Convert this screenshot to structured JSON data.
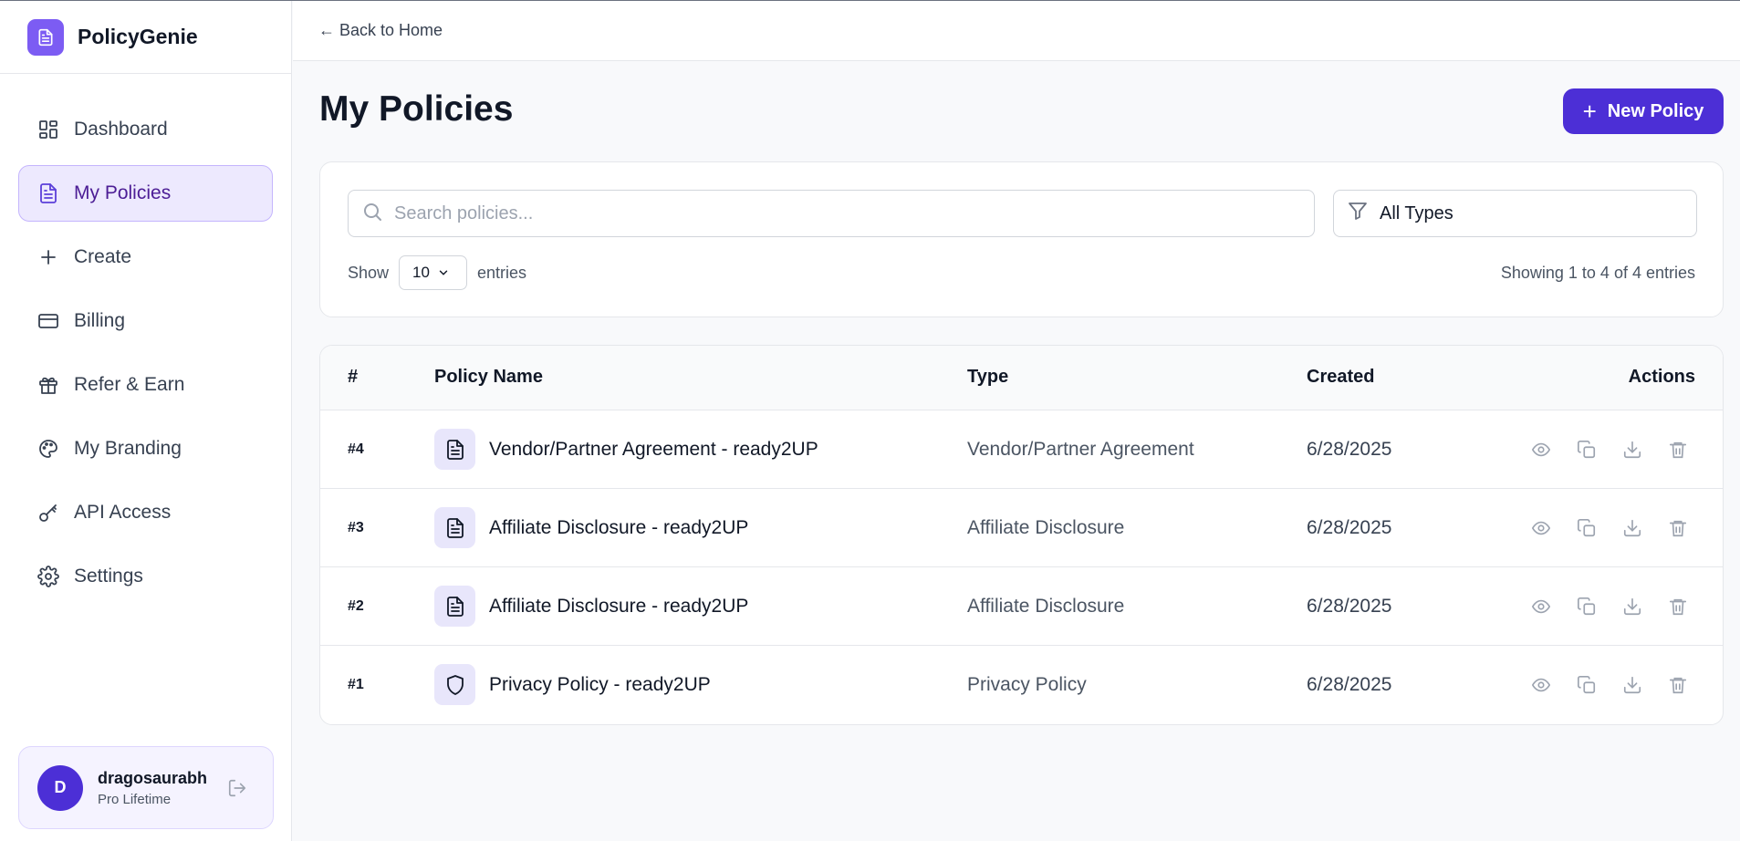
{
  "brand": {
    "name": "PolicyGenie",
    "logo_icon": "document-icon",
    "accent": "#7c5cf3"
  },
  "sidebar": {
    "items": [
      {
        "label": "Dashboard",
        "icon": "dashboard-icon",
        "active": false
      },
      {
        "label": "My Policies",
        "icon": "document-icon",
        "active": true
      },
      {
        "label": "Create",
        "icon": "plus-icon",
        "active": false
      },
      {
        "label": "Billing",
        "icon": "credit-card-icon",
        "active": false
      },
      {
        "label": "Refer & Earn",
        "icon": "gift-icon",
        "active": false
      },
      {
        "label": "My Branding",
        "icon": "palette-icon",
        "active": false
      },
      {
        "label": "API Access",
        "icon": "key-icon",
        "active": false
      },
      {
        "label": "Settings",
        "icon": "gear-icon",
        "active": false
      }
    ],
    "user": {
      "initial": "D",
      "name": "dragosaurabh",
      "plan": "Pro Lifetime"
    }
  },
  "topbar": {
    "back_label": "← Back to Home"
  },
  "main": {
    "title": "My Policies",
    "new_policy_label": "New Policy",
    "search_placeholder": "Search policies...",
    "type_filter": "All Types",
    "show_label": "Show",
    "entries_value": "10",
    "entries_label": "entries",
    "showing_text": "Showing 1 to 4 of 4 entries"
  },
  "table": {
    "headers": {
      "num": "#",
      "name": "Policy Name",
      "type": "Type",
      "created": "Created",
      "actions": "Actions"
    },
    "rows": [
      {
        "num": "#4",
        "icon": "document-icon",
        "name": "Vendor/Partner Agreement - ready2UP",
        "type": "Vendor/Partner Agreement",
        "created": "6/28/2025"
      },
      {
        "num": "#3",
        "icon": "document-icon",
        "name": "Affiliate Disclosure - ready2UP",
        "type": "Affiliate Disclosure",
        "created": "6/28/2025"
      },
      {
        "num": "#2",
        "icon": "document-icon",
        "name": "Affiliate Disclosure - ready2UP",
        "type": "Affiliate Disclosure",
        "created": "6/28/2025"
      },
      {
        "num": "#1",
        "icon": "shield-icon",
        "name": "Privacy Policy - ready2UP",
        "type": "Privacy Policy",
        "created": "6/28/2025"
      }
    ]
  }
}
